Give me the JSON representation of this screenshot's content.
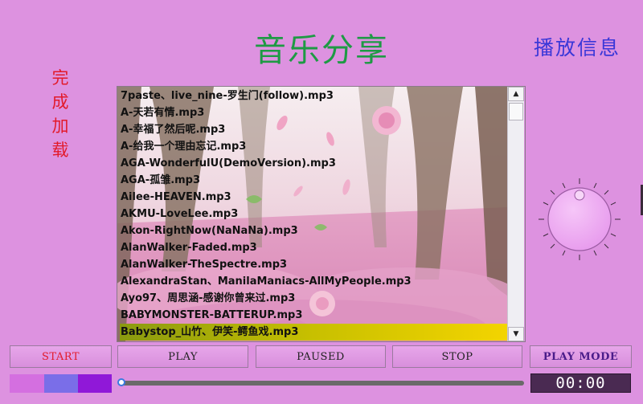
{
  "header": {
    "title": "音乐分享",
    "play_info": "播放信息",
    "vertical_title": [
      "完",
      "成",
      "加",
      "载"
    ]
  },
  "playlist": {
    "songs": [
      "7paste、live_nine-罗生门(follow).mp3",
      "A-天若有情.mp3",
      "A-幸福了然后呢.mp3",
      "A-给我一个理由忘记.mp3",
      "AGA-WonderfulU(DemoVersion).mp3",
      "AGA-孤雏.mp3",
      "Ailee-HEAVEN.mp3",
      "AKMU-LoveLee.mp3",
      "Akon-RightNow(NaNaNa).mp3",
      "AlanWalker-Faded.mp3",
      "AlanWalker-TheSpectre.mp3",
      "AlexandraStan、ManilaManiacs-AllMyPeople.mp3",
      "Ayo97、周思涵-感谢你曾来过.mp3",
      "BABYMONSTER-BATTERUP.mp3",
      "Babystop_山竹、伊笑-鳄鱼戏.mp3"
    ],
    "selected_index": 14
  },
  "controls": {
    "start": "START",
    "play": "PLAY",
    "paused": "PAUSED",
    "stop": "STOP",
    "play_mode": "PLAY MODE"
  },
  "progress": {
    "time": "00:00",
    "fraction": 0.0
  },
  "colors": {
    "background": "#dd92e0",
    "swatches": [
      "#d46fe0",
      "#7a6ee8",
      "#9018d8"
    ]
  },
  "icons": {
    "scroll_up": "▲",
    "scroll_down": "▼"
  }
}
